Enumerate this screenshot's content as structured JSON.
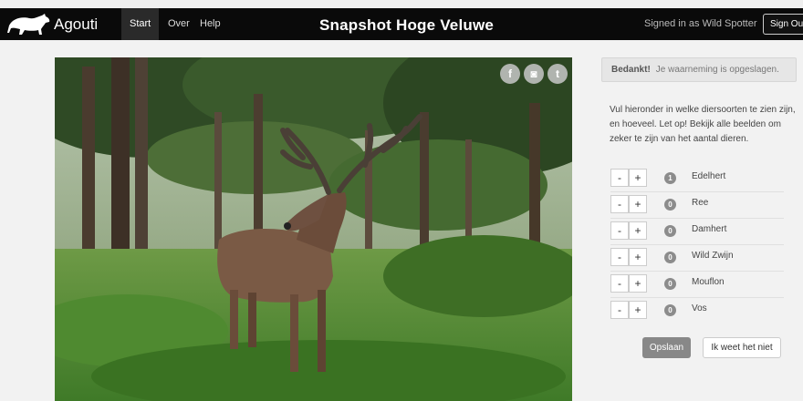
{
  "nav": {
    "brand": "Agouti",
    "items": [
      {
        "label": "Start",
        "active": true
      },
      {
        "label": "Over",
        "active": false
      },
      {
        "label": "Help",
        "active": false
      }
    ],
    "title": "Snapshot Hoge Veluwe",
    "signed_in": "Signed in as Wild Spotter",
    "sign_out": "Sign Out"
  },
  "photo": {
    "subject": "red deer stag with velvet antlers in a pine forest"
  },
  "social": {
    "icons": [
      "facebook-icon",
      "instagram-icon",
      "twitter-icon"
    ],
    "glyphs": [
      "f",
      "◙",
      "t"
    ]
  },
  "alert": {
    "strong": "Bedankt!",
    "text": "Je waarneming is opgeslagen."
  },
  "instructions": "Vul hieronder in welke diersoorten te zien zijn, en hoeveel. Let op! Bekijk alle beelden om zeker te zijn van het aantal dieren.",
  "species": [
    {
      "name": "Edelhert",
      "count": "1"
    },
    {
      "name": "Ree",
      "count": "0"
    },
    {
      "name": "Damhert",
      "count": "0"
    },
    {
      "name": "Wild Zwijn",
      "count": "0"
    },
    {
      "name": "Mouflon",
      "count": "0"
    },
    {
      "name": "Vos",
      "count": "0"
    }
  ],
  "buttons": {
    "minus": "-",
    "plus": "+",
    "save": "Opslaan",
    "unknown": "Ik weet het niet"
  },
  "colors": {
    "navbar": "#0a0a0a",
    "save_button": "#888888",
    "count_badge": "#8c8c8c"
  }
}
